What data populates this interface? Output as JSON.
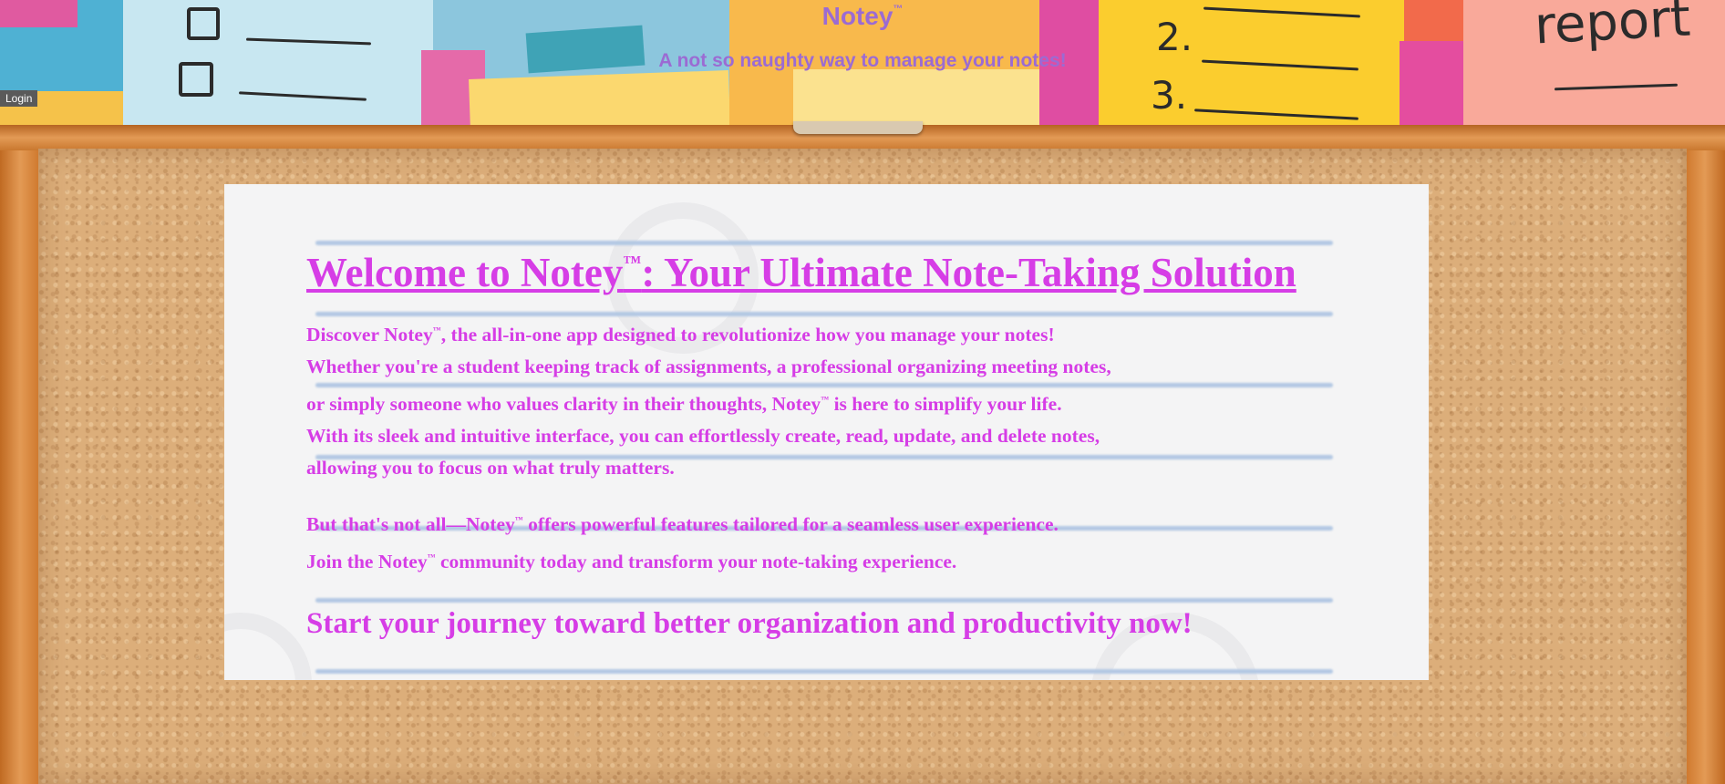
{
  "header": {
    "brand": "Notey",
    "brand_mark": "™",
    "tagline": "A not so naughty way to manage your notes!",
    "login_label": "Login",
    "banner_numbers": [
      "2.",
      "3."
    ],
    "banner_word": "report"
  },
  "main": {
    "heading_a": "Welcome to Notey",
    "heading_mark": "™",
    "heading_b": ": Your Ultimate Note-Taking Solution",
    "p1": {
      "l1a": "Discover Notey",
      "l1b": ", the all-in-one app designed to revolutionize how you manage your notes!",
      "l2": "Whether you're a student keeping track of  assignments, a professional organizing meeting notes,",
      "l3a": "or simply someone who values clarity in their thoughts, Notey",
      "l3b": " is here to simplify your life.",
      "l4": "With its sleek and intuitive interface, you can effortlessly create, read, update, and delete notes,",
      "l5": "allowing you to focus on what truly matters."
    },
    "p2": {
      "l1a": "But that's not all—Notey",
      "l1b": " offers powerful features tailored for a seamless user experience.",
      "l2a": "Join the Notey",
      "l2b": " community today and transform your note-taking experience."
    },
    "tm": "™",
    "cta": "Start your journey toward better organization and productivity now!"
  },
  "colors": {
    "accent": "#d63de6",
    "brand": "#9b6bd3",
    "card": "#f4f4f5"
  }
}
